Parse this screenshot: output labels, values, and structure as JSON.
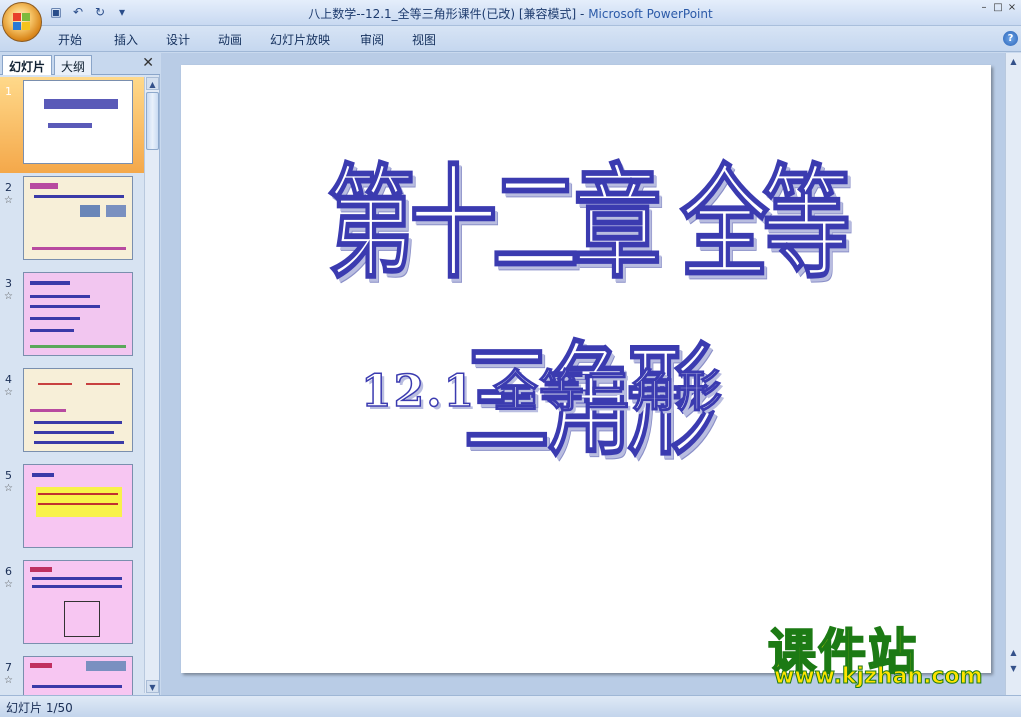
{
  "window": {
    "title": "八上数学--12.1_全等三角形课件(已改)  [兼容模式]",
    "separator": " - ",
    "app_name": "Microsoft PowerPoint"
  },
  "quick_access": {
    "save_icon": "save-icon",
    "undo_icon": "undo-icon",
    "redo_icon": "redo-icon"
  },
  "ribbon": {
    "tabs": [
      {
        "label": "开始"
      },
      {
        "label": "插入"
      },
      {
        "label": "设计"
      },
      {
        "label": "动画"
      },
      {
        "label": "幻灯片放映"
      },
      {
        "label": "审阅"
      },
      {
        "label": "视图"
      }
    ]
  },
  "panel": {
    "tab_slides": "幻灯片",
    "tab_outline": "大纲",
    "slides": [
      {
        "number": "1",
        "star": ""
      },
      {
        "number": "2",
        "star": "☆"
      },
      {
        "number": "3",
        "star": "☆"
      },
      {
        "number": "4",
        "star": "☆"
      },
      {
        "number": "5",
        "star": "☆"
      },
      {
        "number": "6",
        "star": "☆"
      },
      {
        "number": "7",
        "star": "☆"
      }
    ]
  },
  "slide": {
    "title": "第十二章  全等三角形",
    "subtitle": "12.1   全等三角形"
  },
  "watermark": {
    "big": "课件站",
    "url": "www.kjzhan.com"
  },
  "status": {
    "slide_counter": "幻灯片 1/50"
  },
  "colors": {
    "title_stroke": "#3b3bb0",
    "selected_thumb": "#f4a84a",
    "watermark_fill": "#ffe400",
    "watermark_stroke": "#1c7a14"
  }
}
